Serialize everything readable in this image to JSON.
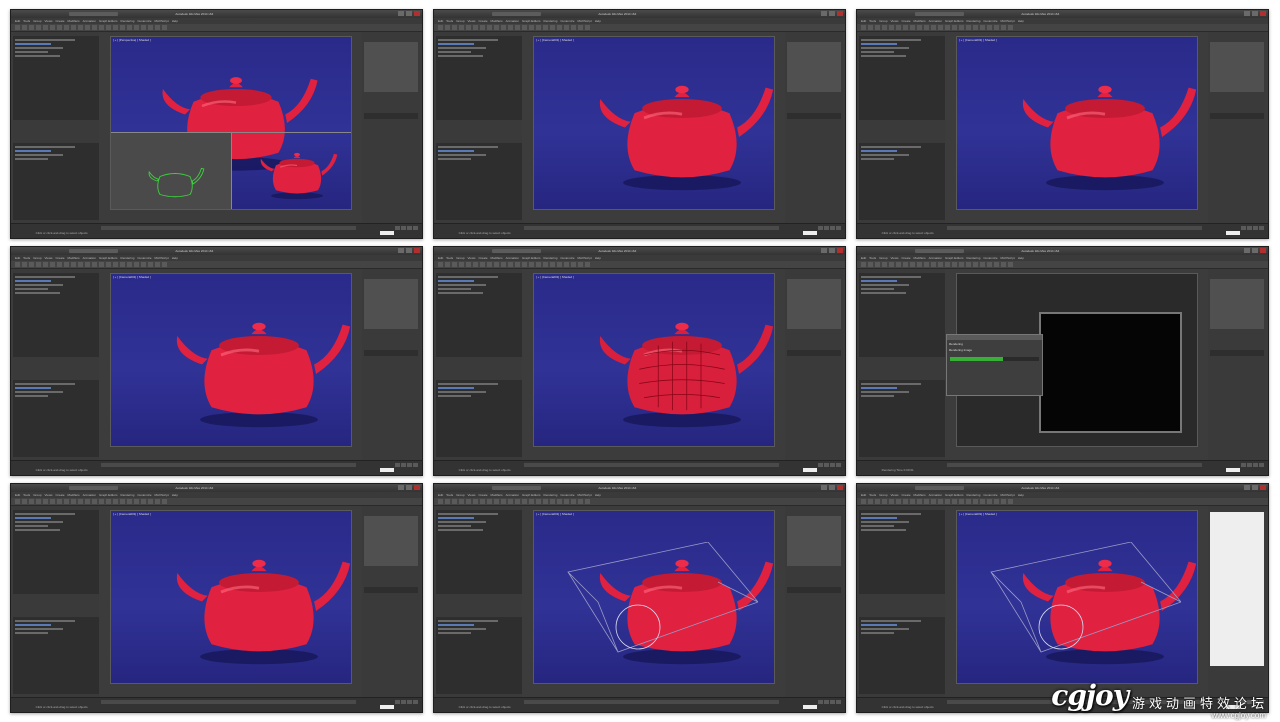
{
  "frames": [
    {
      "id": 1,
      "window_title": "Autodesk 3ds Max 2014 x64",
      "viewport_label": "[ + ] [Perspective] [ Shaded ]",
      "variant": "quad",
      "status_text": "Click or click-and-drag to select objects"
    },
    {
      "id": 2,
      "window_title": "Autodesk 3ds Max 2014 x64",
      "viewport_label": "[ + ] [Camera001] [ Shaded ]",
      "variant": "single",
      "status_text": "Click or click-and-drag to select objects"
    },
    {
      "id": 3,
      "window_title": "Autodesk 3ds Max 2014 x64",
      "viewport_label": "[ + ] [Camera001] [ Shaded ]",
      "variant": "single",
      "status_text": "Click or click-and-drag to select objects"
    },
    {
      "id": 4,
      "window_title": "Autodesk 3ds Max 2014 x64",
      "viewport_label": "[ + ] [Camera001] [ Shaded ]",
      "variant": "single",
      "status_text": "Click or click-and-drag to select objects"
    },
    {
      "id": 5,
      "window_title": "Autodesk 3ds Max 2014 x64",
      "viewport_label": "[ + ] [Camera001] [ Shaded ]",
      "variant": "wire",
      "status_text": "Click or click-and-drag to select objects"
    },
    {
      "id": 6,
      "window_title": "Autodesk 3ds Max 2014 x64",
      "viewport_label": "[ + ] [Camera001] [ Shaded ]",
      "variant": "render",
      "status_text": "Rendering Time 0:00:01"
    },
    {
      "id": 7,
      "window_title": "Autodesk 3ds Max 2014 x64",
      "viewport_label": "[ + ] [Camera001] [ Shaded ]",
      "variant": "single",
      "status_text": "Click or click-and-drag to select objects"
    },
    {
      "id": 8,
      "window_title": "Autodesk 3ds Max 2014 x64",
      "viewport_label": "[ + ] [Camera001] [ Shaded ]",
      "variant": "light",
      "status_text": "Click or click-and-drag to select objects"
    },
    {
      "id": 9,
      "window_title": "Autodesk 3ds Max 2014 x64",
      "viewport_label": "[ + ] [Camera001] [ Shaded ]",
      "variant": "light-list",
      "status_text": "Click or click-and-drag to select objects"
    }
  ],
  "menu_items": [
    "Edit",
    "Tools",
    "Group",
    "Views",
    "Create",
    "Modifiers",
    "Animation",
    "Graph Editors",
    "Rendering",
    "Customize",
    "MAXScript",
    "Help"
  ],
  "dialog": {
    "title": "Rendering",
    "progress_label": "Rendering Image"
  },
  "colors": {
    "viewport": "#2c2c8c",
    "teapot": "#e0213f",
    "ui": "#3c3c3c",
    "wire_green": "#3cd13c"
  },
  "watermark": {
    "logo": "cgjoy",
    "text": "游戏动画特效论坛",
    "url": "www.cgjoy.com"
  }
}
